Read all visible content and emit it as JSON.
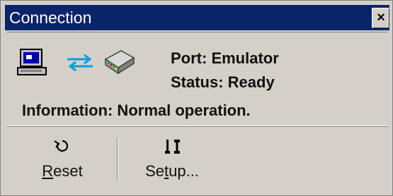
{
  "window": {
    "title": "Connection",
    "close_symbol": "×"
  },
  "status": {
    "port": "Port: Emulator",
    "status": "Status: Ready",
    "information": "Information: Normal operation."
  },
  "icons": {
    "computer": "computer-icon",
    "arrows": "exchange-arrows-icon",
    "modem": "modem-icon",
    "reset": "reset-icon",
    "setup": "setup-tools-icon"
  },
  "toolbar": {
    "reset_first": "R",
    "reset_rest": "eset",
    "setup_before": "Se",
    "setup_underlined": "t",
    "setup_after": "up..."
  },
  "colors": {
    "titlebar": "#0a246a",
    "window": "#d4d0c8"
  }
}
